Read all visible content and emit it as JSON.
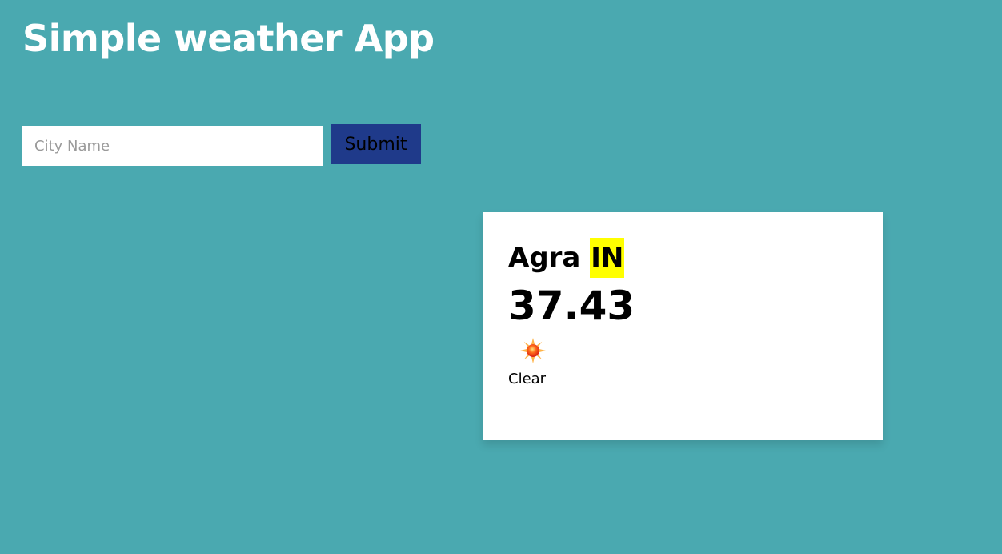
{
  "header": {
    "title": "Simple weather App"
  },
  "search": {
    "placeholder": "City Name",
    "value": "",
    "submit_label": "Submit"
  },
  "weather": {
    "city": "Agra",
    "country": "IN",
    "temperature": "37.43",
    "icon": "sun-icon",
    "condition": "Clear"
  },
  "colors": {
    "background": "#4AA9B0",
    "button": "#1F3A8A",
    "country_highlight": "#FFFF00",
    "card": "#FFFFFF"
  }
}
